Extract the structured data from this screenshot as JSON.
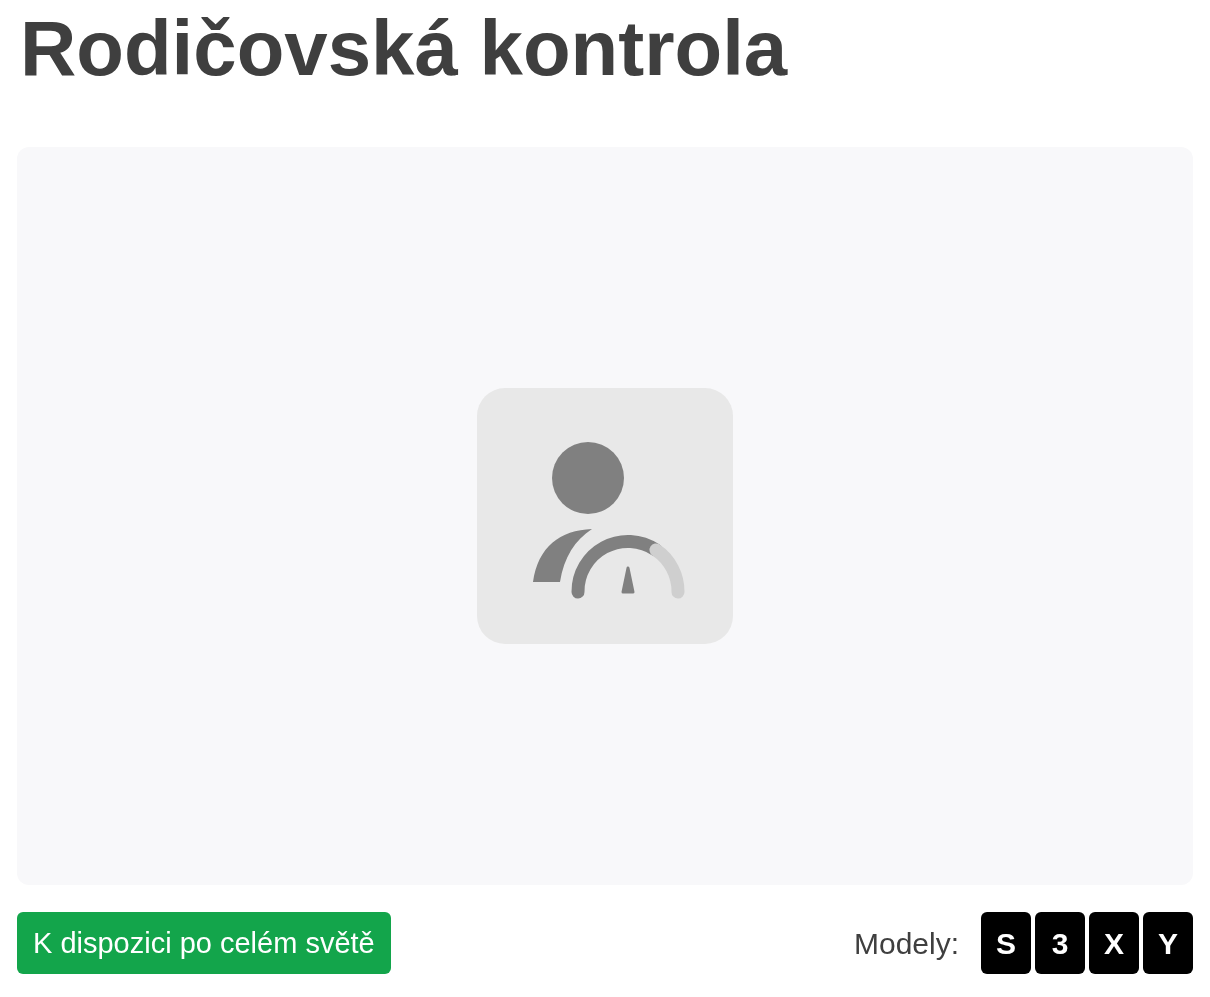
{
  "title": "Rodičovská kontrola",
  "availability_badge": "K dispozici po celém světě",
  "models": {
    "label": "Modely:",
    "items": [
      "S",
      "3",
      "X",
      "Y"
    ]
  }
}
